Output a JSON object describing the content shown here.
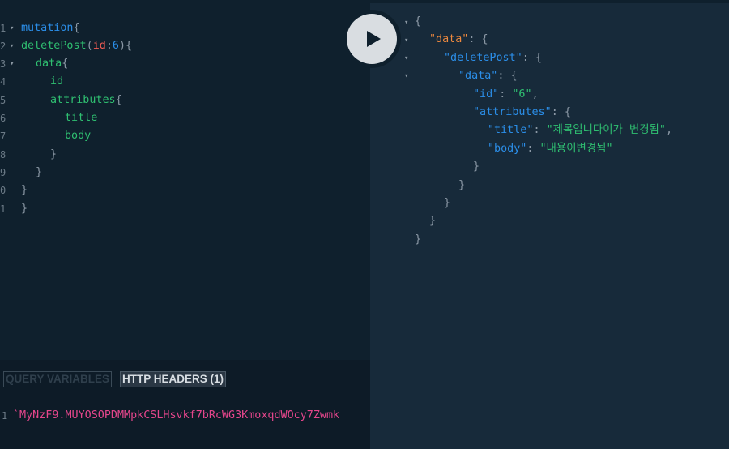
{
  "query_editor": {
    "lines": [
      {
        "num": "1",
        "fold": true
      },
      {
        "num": "2",
        "fold": true
      },
      {
        "num": "3",
        "fold": true
      },
      {
        "num": "4",
        "fold": false
      },
      {
        "num": "5",
        "fold": false
      },
      {
        "num": "6",
        "fold": false
      },
      {
        "num": "7",
        "fold": false
      },
      {
        "num": "8",
        "fold": false
      },
      {
        "num": "9",
        "fold": false
      },
      {
        "num": "0",
        "fold": false
      },
      {
        "num": "1",
        "fold": false
      }
    ],
    "tokens": {
      "mutation": "mutation",
      "brace_open": "{",
      "brace_close": "}",
      "delete_post": "deletePost",
      "paren_open": "(",
      "arg_id": "id",
      "colon": ":",
      "arg_value": "6",
      "paren_close": ")",
      "data": "data",
      "id": "id",
      "attributes": "attributes",
      "title": "title",
      "body": "body"
    }
  },
  "variables_panel": {
    "tabs": [
      {
        "label": "QUERY VARIABLES",
        "active": false
      },
      {
        "label": "HTTP HEADERS (1)",
        "active": true
      }
    ],
    "line_number": "1",
    "content": "`MyNzF9.MUYOSOPDMMpkCSLHsvkf7bRcWG3KmoxqdWOcy7Zwmk"
  },
  "result": {
    "open_brace": "{",
    "close_brace": "}",
    "key_data": "\"data\"",
    "key_delete_post": "\"deletePost\"",
    "key_inner_data": "\"data\"",
    "key_id": "\"id\"",
    "val_id": "\"6\"",
    "key_attributes": "\"attributes\"",
    "key_title": "\"title\"",
    "val_title": "\"제목입니다이가 변경됨\"",
    "key_body": "\"body\"",
    "val_body": "\"내용이변경됨\"",
    "colon_space": ": ",
    "comma": ","
  },
  "run_button": {
    "icon": "play-icon"
  }
}
